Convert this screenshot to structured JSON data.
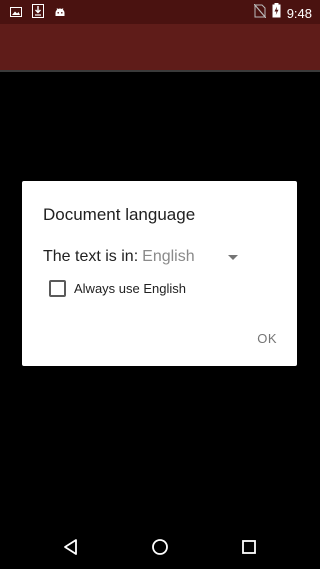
{
  "status_bar": {
    "time": "9:48",
    "left_icons": [
      "image-icon",
      "download-icon",
      "android-icon"
    ],
    "right_icons": [
      "no-sim-icon",
      "battery-charging-icon"
    ]
  },
  "colors": {
    "status_bar": "#4a1210",
    "app_bar": "#5f1c19",
    "dialog_bg": "#ffffff",
    "background": "#000000"
  },
  "dialog": {
    "title": "Document language",
    "language_label": "The text is in:",
    "language_value": "English",
    "checkbox_label": "Always use English",
    "checkbox_checked": false,
    "ok_label": "OK"
  },
  "nav_bar": {
    "buttons": [
      "back-icon",
      "home-icon",
      "recents-icon"
    ]
  }
}
